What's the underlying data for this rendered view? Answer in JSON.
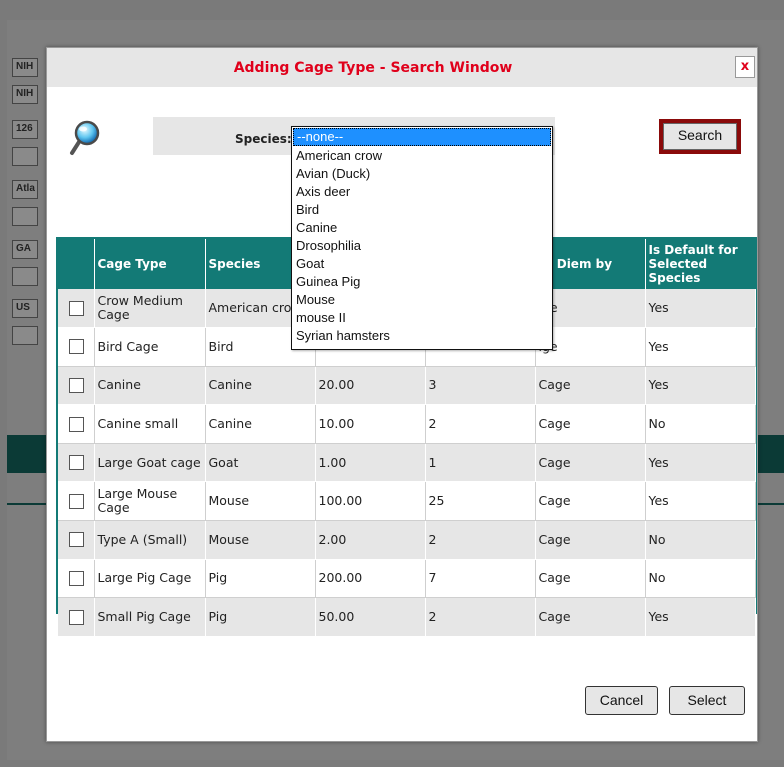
{
  "background": {
    "fields": [
      "NIH",
      "NIH",
      "126",
      "",
      "Atla",
      "",
      "GA",
      "",
      "US",
      ""
    ]
  },
  "dialog": {
    "title": "Adding Cage Type - Search Window",
    "close_label": "x",
    "species_label": "Species:",
    "search_label": "Search",
    "cancel_label": "Cancel",
    "select_label": "Select"
  },
  "dropdown": {
    "options": [
      "--none--",
      "American crow",
      "Avian (Duck)",
      "Axis deer",
      "Bird",
      "Canine",
      "Drosophilia",
      "Goat",
      "Guinea Pig",
      "Mouse",
      "mouse II",
      "Syrian hamsters"
    ],
    "selected": "--none--"
  },
  "table": {
    "headers": [
      "",
      "Cage Type",
      "Species",
      "",
      "",
      "er Diem by",
      "Is Default for Selected Species"
    ],
    "rows": [
      [
        "",
        "Crow Medium Cage",
        "American crow",
        "",
        "",
        "ıge",
        "Yes"
      ],
      [
        "",
        "Bird Cage",
        "Bird",
        "",
        "",
        "ıge",
        "Yes"
      ],
      [
        "",
        "Canine",
        "Canine",
        "20.00",
        "3",
        "Cage",
        "Yes"
      ],
      [
        "",
        "Canine small",
        "Canine",
        "10.00",
        "2",
        "Cage",
        "No"
      ],
      [
        "",
        "Large Goat cage",
        "Goat",
        "1.00",
        "1",
        "Cage",
        "Yes"
      ],
      [
        "",
        "Large Mouse Cage",
        "Mouse",
        "100.00",
        "25",
        "Cage",
        "Yes"
      ],
      [
        "",
        "Type A (Small)",
        "Mouse",
        "2.00",
        "2",
        "Cage",
        "No"
      ],
      [
        "",
        "Large Pig Cage",
        "Pig",
        "200.00",
        "7",
        "Cage",
        "No"
      ],
      [
        "",
        "Small Pig Cage",
        "Pig",
        "50.00",
        "2",
        "Cage",
        "Yes"
      ]
    ]
  },
  "colors": {
    "accent_teal": "#137a76",
    "title_red": "#e0001b",
    "search_border": "#8a0a0a",
    "dropdown_highlight": "#1e90ff"
  }
}
